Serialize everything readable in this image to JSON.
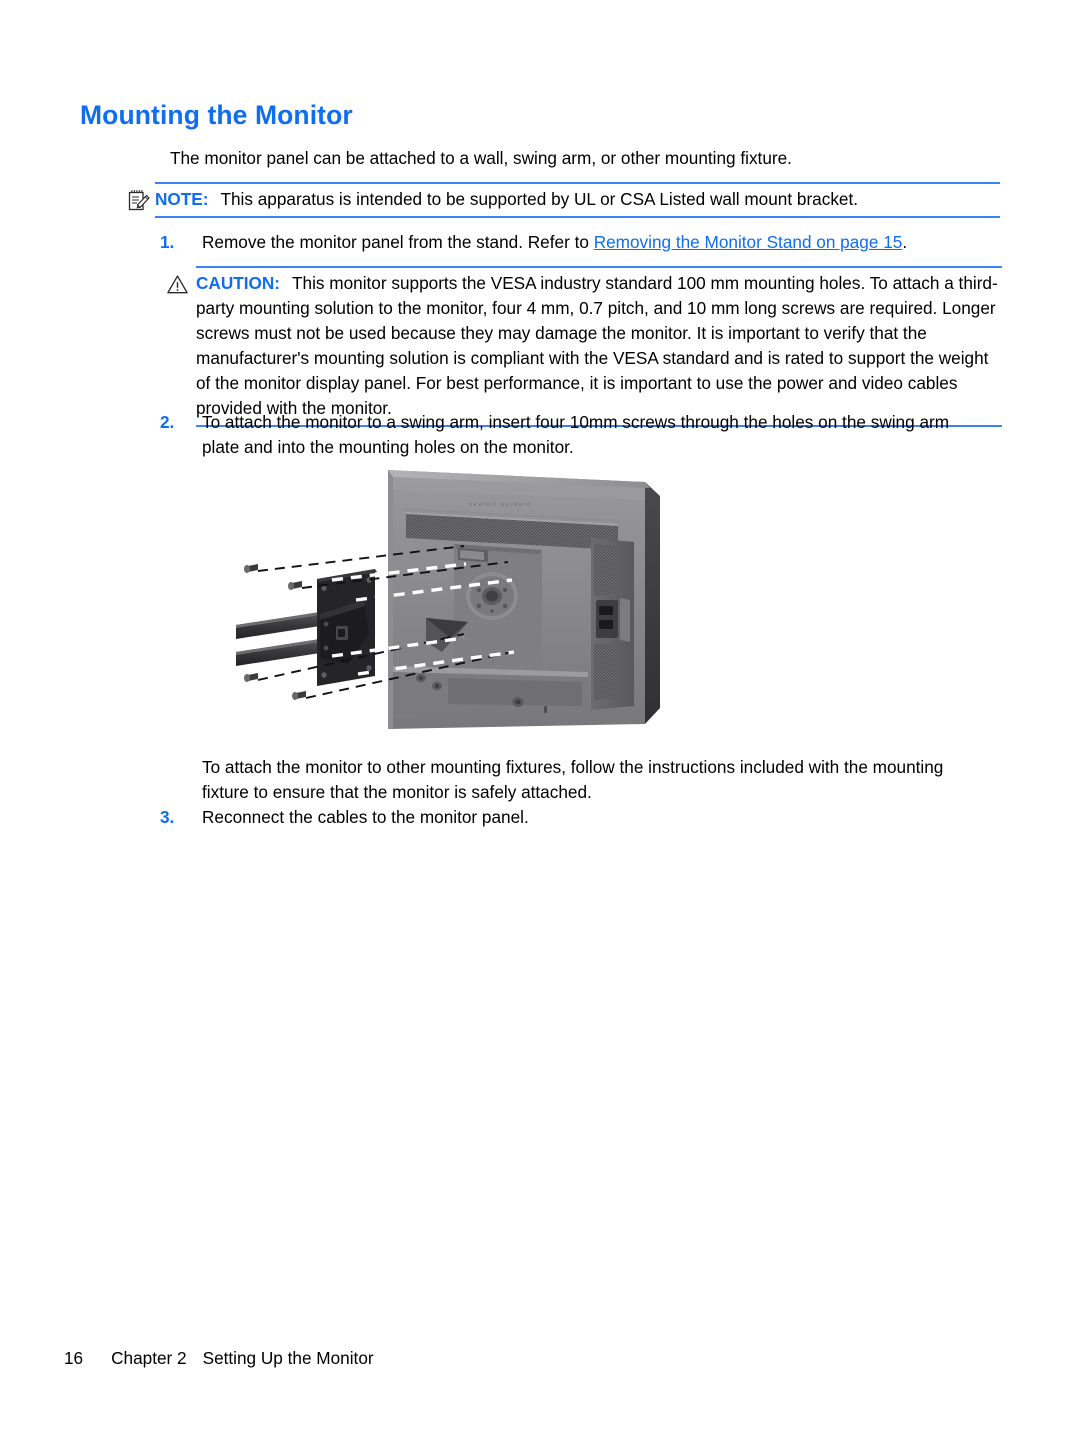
{
  "heading": "Mounting the Monitor",
  "intro": "The monitor panel can be attached to a wall, swing arm, or other mounting fixture.",
  "note": {
    "icon": "note-pencil-icon",
    "label": "NOTE:",
    "text": "This apparatus is intended to be supported by UL or CSA Listed wall mount bracket."
  },
  "caution": {
    "icon": "warning-triangle-icon",
    "label": "CAUTION:",
    "text": "This monitor supports the VESA industry standard 100 mm mounting holes. To attach a third-party mounting solution to the monitor, four 4 mm, 0.7 pitch, and 10 mm long screws are required. Longer screws must not be used because they may damage the monitor. It is important to verify that the manufacturer's mounting solution is compliant with the VESA standard and is rated to support the weight of the monitor display panel. For best performance, it is important to use the power and video cables provided with the monitor."
  },
  "steps": [
    {
      "num": "1.",
      "text_before": "Remove the monitor panel from the stand. Refer to ",
      "link": "Removing the Monitor Stand on page 15",
      "text_after": "."
    },
    {
      "num": "2.",
      "text": "To attach the monitor to a swing arm, insert four 10mm screws through the holes on the swing arm plate and into the mounting holes on the monitor."
    },
    {
      "num": "3.",
      "text": "Reconnect the cables to the monitor panel."
    }
  ],
  "closing_para": "To attach the monitor to other mounting fixtures, follow the instructions included with the mounting fixture to ensure that the monitor is safely attached.",
  "figure": {
    "name": "monitor-vesa-mount-illustration",
    "brand_text": "hewlett packard"
  },
  "footer": {
    "page_number": "16",
    "chapter": "Chapter 2",
    "chapter_title": "Setting Up the Monitor"
  },
  "colors": {
    "accent_blue": "#0f6ef0",
    "rule_blue": "#3b82f6",
    "text_black": "#000000",
    "figure_body": "#8a8a8c",
    "figure_dark": "#4f4f52",
    "figure_plate": "#262628"
  }
}
